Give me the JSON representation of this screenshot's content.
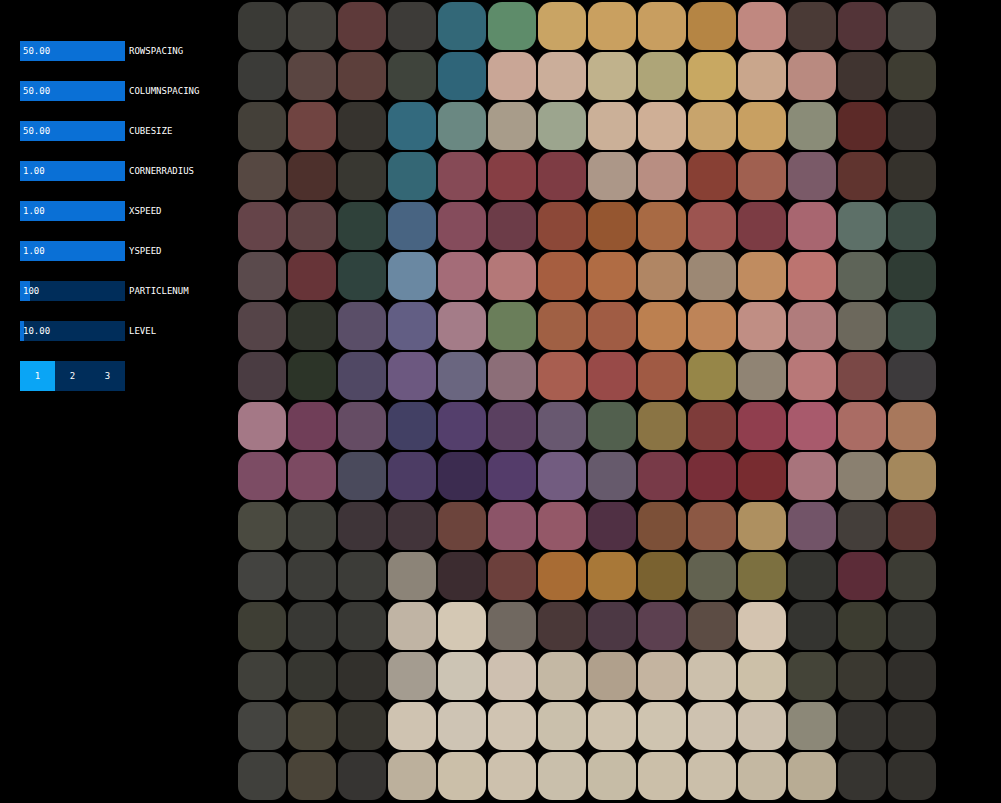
{
  "sliders": [
    {
      "label": "ROWSPACING",
      "value": "50.00",
      "level": 1.0
    },
    {
      "label": "COLUMNSPACING",
      "value": "50.00",
      "level": 1.0
    },
    {
      "label": "CUBESIZE",
      "value": "50.00",
      "level": 1.0
    },
    {
      "label": "CORNERRADIUS",
      "value": "1.00",
      "level": 1.0
    },
    {
      "label": "XSPEED",
      "value": "1.00",
      "level": 1.0
    },
    {
      "label": "YSPEED",
      "value": "1.00",
      "level": 1.0
    },
    {
      "label": "PARTICLENUM",
      "value": "100",
      "level": 0.1
    },
    {
      "label": "LEVEL",
      "value": "10.00",
      "level": 0.04
    }
  ],
  "tabs": [
    {
      "label": "1",
      "selected": true
    },
    {
      "label": "2",
      "selected": false
    },
    {
      "label": "3",
      "selected": false
    }
  ],
  "grid": [
    [
      "#3a3a36",
      "#42403b",
      "#5e3a3a",
      "#3d3b38",
      "#336878",
      "#5e8c6a",
      "#c9a464",
      "#c9a060",
      "#c89e60",
      "#b58544",
      "#c08880",
      "#4a3a36",
      "#533438",
      "#46443e"
    ],
    [
      "#3b3b38",
      "#5a4541",
      "#5c3f3b",
      "#3f443c",
      "#2f6579",
      "#c9a696",
      "#cbae9a",
      "#c0b28c",
      "#aea578",
      "#c8a862",
      "#c9a68c",
      "#b98a80",
      "#403430",
      "#3e3d32"
    ],
    [
      "#444039",
      "#704441",
      "#36332e",
      "#336a7e",
      "#6a8882",
      "#a89c8a",
      "#9ca58e",
      "#cbb098",
      "#cfaf96",
      "#c8a46c",
      "#c8a062",
      "#8a8c78",
      "#5c2a28",
      "#34302c"
    ],
    [
      "#564842",
      "#4d302c",
      "#383731",
      "#346775",
      "#864a56",
      "#863e44",
      "#7e3c44",
      "#ac9788",
      "#b88e82",
      "#884034",
      "#a06050",
      "#7a5a68",
      "#60342f",
      "#35322c"
    ],
    [
      "#654449",
      "#5e4244",
      "#2f413a",
      "#486482",
      "#854c5c",
      "#6c3c48",
      "#8c4838",
      "#955630",
      "#a86a44",
      "#9c5450",
      "#7c3c44",
      "#a86670",
      "#5d7068",
      "#3b4b44"
    ],
    [
      "#5a4a4c",
      "#673438",
      "#2f433e",
      "#6a88a2",
      "#a46c78",
      "#b47878",
      "#a65e40",
      "#b06c44",
      "#b08664",
      "#9c8874",
      "#c08c60",
      "#bc7470",
      "#5e6458",
      "#2f3c34"
    ],
    [
      "#554448",
      "#30342c",
      "#5a4e68",
      "#625e84",
      "#a47c88",
      "#6a7e5a",
      "#a06044",
      "#a05c44",
      "#bc8050",
      "#be8458",
      "#c08e84",
      "#b07c7c",
      "#6c685c",
      "#3c4c44"
    ],
    [
      "#4a3c42",
      "#2c3428",
      "#504864",
      "#6c5880",
      "#6a6680",
      "#8c6e78",
      "#a85e50",
      "#984a48",
      "#a05a44",
      "#968648",
      "#908474",
      "#b87878",
      "#7a4846",
      "#3d3a3c"
    ],
    [
      "#a47886",
      "#703e58",
      "#654c64",
      "#424064",
      "#543f6c",
      "#5a4060",
      "#685870",
      "#52604e",
      "#8a7444",
      "#7e3c3a",
      "#903e4e",
      "#a85a6c",
      "#aa6c64",
      "#a8785c"
    ],
    [
      "#7c4c64",
      "#7c4a62",
      "#4a4a5c",
      "#4c3c64",
      "#3c2c50",
      "#543c6a",
      "#725c80",
      "#665a6c",
      "#783a48",
      "#782e38",
      "#782c30",
      "#a8747c",
      "#8a8070",
      "#a4885c"
    ],
    [
      "#4a4a40",
      "#40403a",
      "#3e3438",
      "#42343a",
      "#6c443c",
      "#8c5468",
      "#945868",
      "#503044",
      "#7c5038",
      "#8c5844",
      "#ae9060",
      "#725468",
      "#443e3a",
      "#5a3432"
    ],
    [
      "#434340",
      "#3c3c38",
      "#3c3c38",
      "#8c8478",
      "#3c2c30",
      "#6c403c",
      "#a86c34",
      "#a87838",
      "#7a6230",
      "#626250",
      "#7c7040",
      "#343430",
      "#5c2c38",
      "#3c3c34"
    ],
    [
      "#3e3e34",
      "#383834",
      "#383834",
      "#c0b4a4",
      "#d4c8b4",
      "#706860",
      "#4a3838",
      "#4c3844",
      "#5c4050",
      "#5c4c44",
      "#d4c4b0",
      "#343430",
      "#3c3c30",
      "#34342f"
    ],
    [
      "#40403a",
      "#363630",
      "#32302c",
      "#a49c90",
      "#ccc4b4",
      "#cec0b0",
      "#c4b8a4",
      "#b0a08c",
      "#c4b4a0",
      "#ccc0ac",
      "#ccc0a8",
      "#444438",
      "#3a3830",
      "#302e2a"
    ],
    [
      "#444440",
      "#484438",
      "#36342e",
      "#cfc3b1",
      "#cec4b4",
      "#d0c4b2",
      "#cac0ac",
      "#cec2ae",
      "#cfc4b0",
      "#cec2b0",
      "#ccc0ae",
      "#8c8878",
      "#34322e",
      "#302e2a"
    ],
    [
      "#40403c",
      "#4a4438",
      "#363432",
      "#bcb09c",
      "#cbbfa9",
      "#cdc1ad",
      "#c9bfab",
      "#c6bca6",
      "#cbbfa9",
      "#cbbfaa",
      "#c4b8a2",
      "#b8ac94",
      "#363430",
      "#32302c"
    ]
  ]
}
